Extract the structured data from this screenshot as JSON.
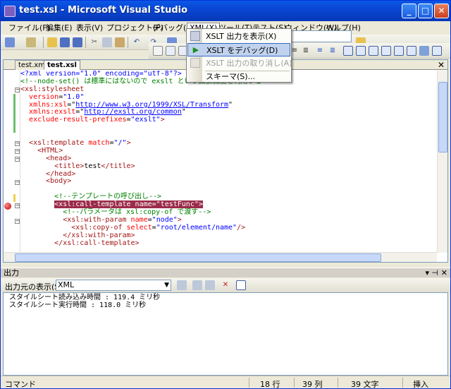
{
  "window": {
    "title": "test.xsl - Microsoft Visual Studio"
  },
  "menu": {
    "items": [
      "ファイル(F)",
      "編集(E)",
      "表示(V)",
      "プロジェクト(P)",
      "デバッグ(D)",
      "XML(X)",
      "ツール(T)",
      "テスト(S)",
      "ウィンドウ(W)",
      "ヘルプ(H)"
    ]
  },
  "xml_menu": {
    "items": [
      {
        "label": "XSLT 出力を表示(X)",
        "icon": "xslt-output-icon",
        "state": "normal"
      },
      {
        "label": "XSLT をデバッグ(D)",
        "icon": "debug-play-icon",
        "state": "highlighted"
      },
      {
        "label": "XSLT 出力の取り消し(A)",
        "icon": "cancel-output-icon",
        "state": "disabled"
      },
      {
        "label": "スキーマ(S)...",
        "icon": "",
        "state": "normal"
      }
    ]
  },
  "doc_tabs": [
    "test.xml",
    "test.xsl"
  ],
  "code_lines": [
    [
      [
        "pi",
        "<?xml version=\"1.0\" encoding=\"utf-8\"?>"
      ]
    ],
    [
      [
        "com",
        "<!--node-set() は標準にはないので exslt という拡張機能を利用する -->"
      ]
    ],
    [
      [
        "tag",
        "<xsl:stylesheet"
      ]
    ],
    [
      [
        "txt",
        "  "
      ],
      [
        "attr",
        "version"
      ],
      [
        "txt",
        "="
      ],
      [
        "val",
        "\"1.0\""
      ]
    ],
    [
      [
        "txt",
        "  "
      ],
      [
        "attr",
        "xmlns:xsl"
      ],
      [
        "txt",
        "=\""
      ],
      [
        "url",
        "http://www.w3.org/1999/XSL/Transform"
      ],
      [
        "txt",
        "\""
      ]
    ],
    [
      [
        "txt",
        "  "
      ],
      [
        "attr",
        "xmlns:exslt"
      ],
      [
        "txt",
        "=\""
      ],
      [
        "url",
        "http://exslt.org/common"
      ],
      [
        "txt",
        "\""
      ]
    ],
    [
      [
        "txt",
        "  "
      ],
      [
        "attr",
        "exclude-result-prefixes"
      ],
      [
        "txt",
        "="
      ],
      [
        "val",
        "\"exslt\""
      ],
      [
        "tag",
        ">"
      ]
    ],
    [
      [
        "txt",
        ""
      ]
    ],
    [
      [
        "txt",
        ""
      ]
    ],
    [
      [
        "txt",
        "  "
      ],
      [
        "tag",
        "<xsl:template "
      ],
      [
        "attr",
        "match"
      ],
      [
        "txt",
        "="
      ],
      [
        "val",
        "\"/\""
      ],
      [
        "tag",
        ">"
      ]
    ],
    [
      [
        "txt",
        "    "
      ],
      [
        "tag",
        "<HTML>"
      ]
    ],
    [
      [
        "txt",
        "      "
      ],
      [
        "tag",
        "<head>"
      ]
    ],
    [
      [
        "txt",
        "        "
      ],
      [
        "tag",
        "<title>"
      ],
      [
        "txt",
        "test"
      ],
      [
        "tag",
        "</title>"
      ]
    ],
    [
      [
        "txt",
        "      "
      ],
      [
        "tag",
        "</head>"
      ]
    ],
    [
      [
        "txt",
        "      "
      ],
      [
        "tag",
        "<body>"
      ]
    ],
    [
      [
        "txt",
        ""
      ]
    ],
    [
      [
        "txt",
        "        "
      ],
      [
        "com",
        "<!--テンプレートの呼び出し-->"
      ]
    ],
    [
      [
        "txt",
        "        "
      ],
      [
        "hl",
        "<xsl:call-template name=\"testFunc\">"
      ]
    ],
    [
      [
        "txt",
        "          "
      ],
      [
        "com",
        "<!--パラメータは xsl:copy-of で渡す-->"
      ]
    ],
    [
      [
        "txt",
        "          "
      ],
      [
        "tag",
        "<xsl:with-param "
      ],
      [
        "attr",
        "name"
      ],
      [
        "txt",
        "="
      ],
      [
        "val",
        "\"node\""
      ],
      [
        "tag",
        ">"
      ]
    ],
    [
      [
        "txt",
        "            "
      ],
      [
        "tag",
        "<xsl:copy-of "
      ],
      [
        "attr",
        "select"
      ],
      [
        "txt",
        "="
      ],
      [
        "val",
        "\"root/element/name\""
      ],
      [
        "tag",
        "/>"
      ]
    ],
    [
      [
        "txt",
        "          "
      ],
      [
        "tag",
        "</xsl:with-param>"
      ]
    ],
    [
      [
        "txt",
        "        "
      ],
      [
        "tag",
        "</xsl:call-template>"
      ]
    ],
    [
      [
        "txt",
        ""
      ]
    ]
  ],
  "output_panel": {
    "title": "出力",
    "source_label": "出力元の表示(S):",
    "source_value": "XML",
    "lines": [
      "スタイルシート読み込み時間 : 119.4 ミリ秒",
      "スタイルシート実行時間 : 118.0 ミリ秒"
    ]
  },
  "status": {
    "mode": "コマンド",
    "line": "18 行",
    "col": "39 列",
    "char": "39 文字",
    "ins": "挿入"
  },
  "colors": {
    "titlebar": "#0a46d4",
    "highlight": "#9b2b4a",
    "menu_highlight": "#c1d2ee"
  }
}
